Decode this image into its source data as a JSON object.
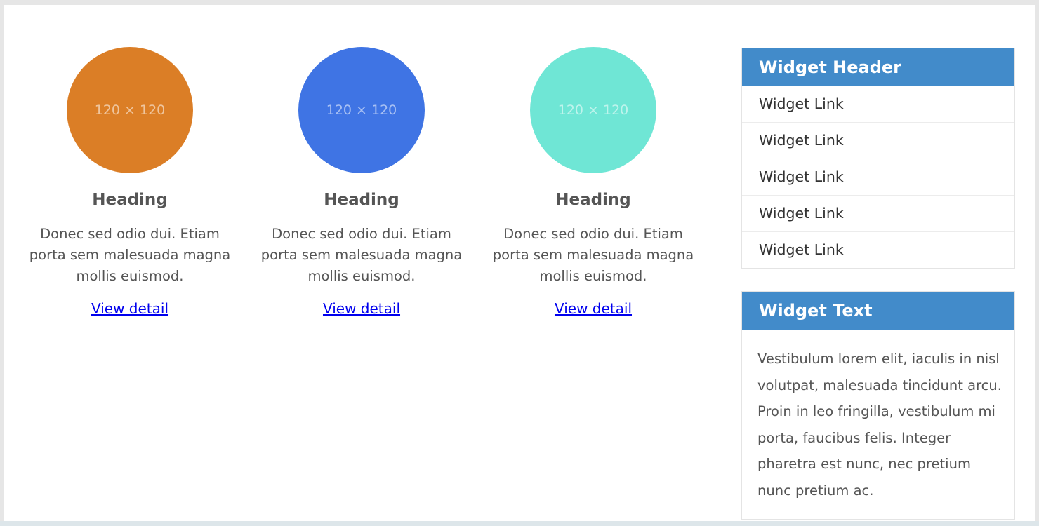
{
  "features": [
    {
      "placeholder": "120 × 120",
      "color": "#db7e26",
      "heading": "Heading",
      "text": "Donec sed odio dui. Etiam porta sem malesuada magna mollis euismod.",
      "link": "View detail"
    },
    {
      "placeholder": "120 × 120",
      "color": "#3f74e4",
      "heading": "Heading",
      "text": "Donec sed odio dui. Etiam porta sem malesuada magna mollis euismod.",
      "link": "View detail"
    },
    {
      "placeholder": "120 × 120",
      "color": "#6fe6d5",
      "heading": "Heading",
      "text": "Donec sed odio dui. Etiam porta sem malesuada magna mollis euismod.",
      "link": "View detail"
    }
  ],
  "widget_links": {
    "header": "Widget Header",
    "links": [
      "Widget Link",
      "Widget Link",
      "Widget Link",
      "Widget Link",
      "Widget Link"
    ]
  },
  "widget_text": {
    "header": "Widget Text",
    "body": "Vestibulum lorem elit, iaculis in nisl volutpat, malesuada tincidunt arcu. Proin in leo fringilla, vestibulum mi porta, faucibus felis. Integer pharetra est nunc, nec pretium nunc pretium ac."
  },
  "colors": {
    "widget_header_bg": "#428bca",
    "link": "#0000ee"
  }
}
